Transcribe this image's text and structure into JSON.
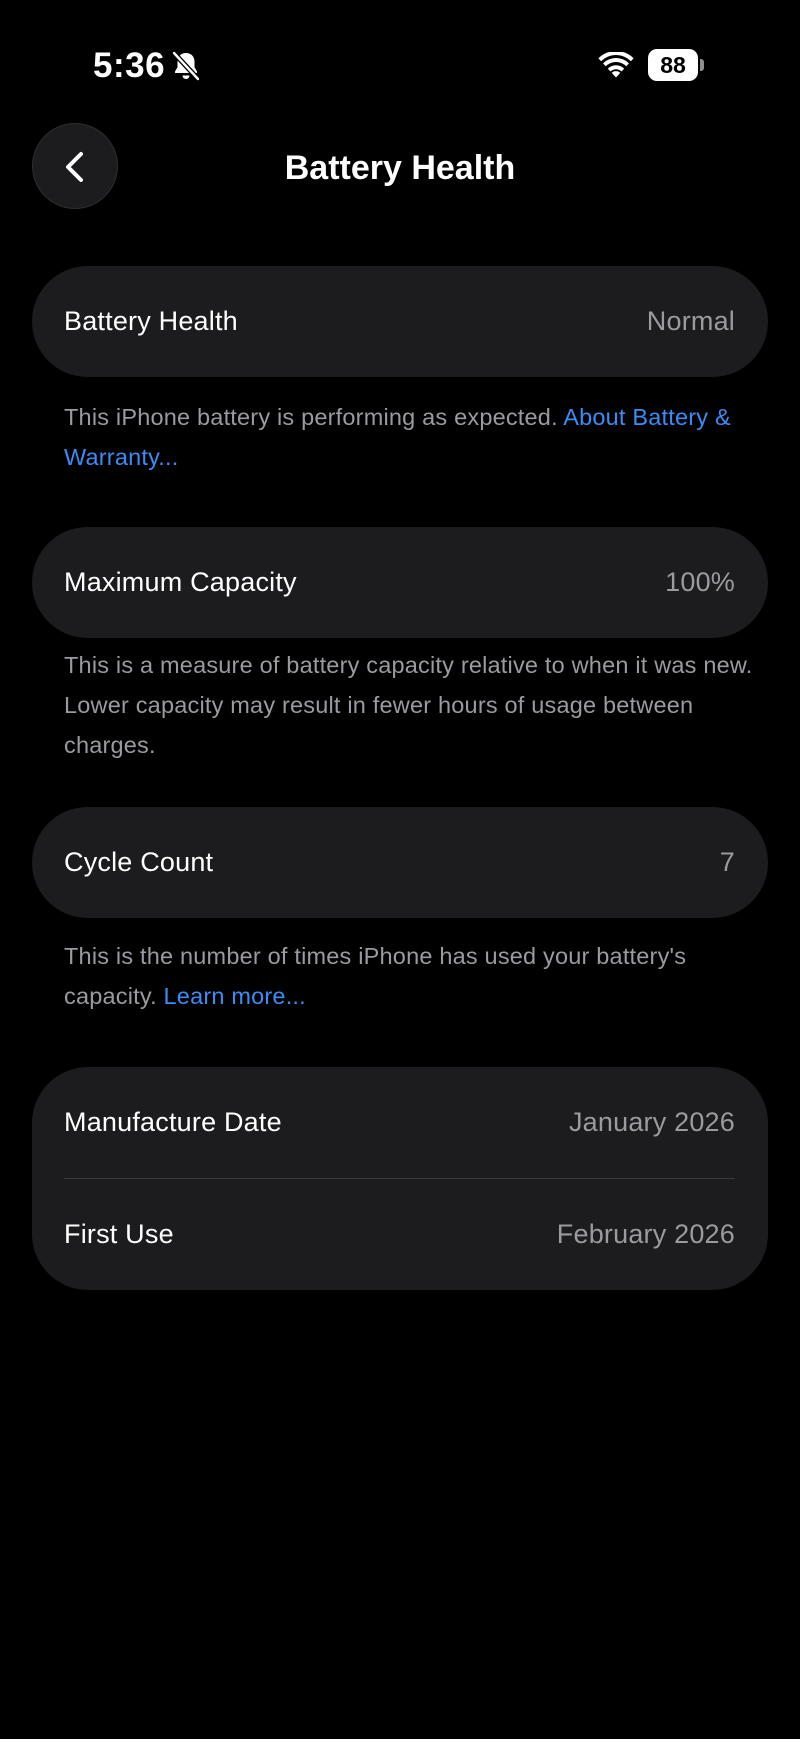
{
  "status_bar": {
    "time": "5:36",
    "battery_level": "88",
    "icons": [
      "bell-slash-icon",
      "wifi-icon",
      "battery-icon"
    ]
  },
  "nav": {
    "title": "Battery Health",
    "back_icon": "chevron-left-icon"
  },
  "battery_health": {
    "label": "Battery Health",
    "value": "Normal",
    "footnote": "This iPhone battery is performing as expected. ",
    "footnote_link": "About Battery & Warranty..."
  },
  "maximum_capacity": {
    "label": "Maximum Capacity",
    "value": "100%",
    "footnote": "This is a measure of battery capacity relative to when it was new. Lower capacity may result in fewer hours of usage between charges."
  },
  "cycle_count": {
    "label": "Cycle Count",
    "value": "7",
    "footnote": "This is the number of times iPhone has used your battery's capacity. ",
    "footnote_link": "Learn more..."
  },
  "dates": {
    "manufacture_label": "Manufacture Date",
    "manufacture_value": "January 2026",
    "first_use_label": "First Use",
    "first_use_value": "February 2026"
  },
  "colors": {
    "background": "#000000",
    "card": "#1c1c1e",
    "secondary_text": "#9a9aa0",
    "link": "#3a8cf6"
  }
}
